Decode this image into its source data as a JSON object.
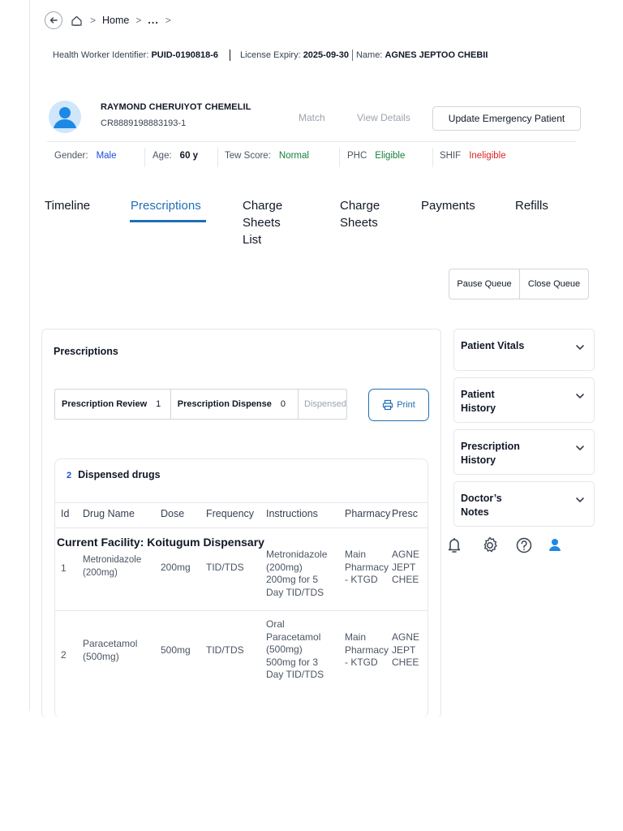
{
  "breadcrumb": {
    "home": "Home",
    "ellipsis": "...",
    "sep": ">"
  },
  "identity": {
    "worker_label": "Health Worker Identifier:",
    "worker_id": "PUID-0190818-6",
    "license_label": "License Expiry:",
    "license_date": "2025-09-30",
    "name_label": "Name:",
    "name_value": "AGNES JEPTOO CHEBII"
  },
  "patient": {
    "name": "RAYMOND CHERUIYOT CHEMELIL",
    "id": "CR8889198883193-1",
    "match": "Match",
    "view_details": "View Details",
    "update_emergency": "Update Emergency Patient"
  },
  "demographics": {
    "gender_label": "Gender:",
    "gender": "Male",
    "age_label": "Age:",
    "age": "60 y",
    "tew_label": "Tew Score:",
    "tew": "Normal",
    "phc_label": "PHC",
    "phc": "Eligible",
    "shif_label": "SHIF",
    "shif": "Ineligible"
  },
  "tabs": [
    {
      "label_lines": [
        "Timeline"
      ]
    },
    {
      "label_lines": [
        "Prescriptions"
      ]
    },
    {
      "label_lines": [
        "Charge",
        "Sheets",
        "List"
      ]
    },
    {
      "label_lines": [
        "Charge",
        "Sheets"
      ]
    },
    {
      "label_lines": [
        "Payments"
      ]
    },
    {
      "label_lines": [
        "Refills"
      ]
    }
  ],
  "queue": {
    "pause": "Pause Queue",
    "close": "Close Queue"
  },
  "prescriptions": {
    "title": "Prescriptions",
    "review_label": "Prescription Review",
    "review_count": "1",
    "dispense_label": "Prescription Dispense",
    "dispense_count": "0",
    "dispensed_label": "Dispensed",
    "print_label": "Print"
  },
  "dispensed": {
    "count": "2",
    "title": "Dispensed drugs",
    "headers": [
      "Id",
      "Drug Name",
      "Dose",
      "Frequency",
      "Instructions",
      "Pharmacy",
      "Presc"
    ],
    "facility": "Current Facility: Koitugum Dispensary",
    "rows": [
      {
        "id": "1",
        "drug_lines": [
          "Metronidazole",
          "(200mg)"
        ],
        "dose": "200mg",
        "frequency": "TID/TDS",
        "instruction_lines": [
          "Metronidazole",
          "(200mg)",
          "200mg for 5",
          "Day TID/TDS"
        ],
        "pharmacy_lines": [
          "Main",
          "Pharmacy",
          "- KTGD"
        ],
        "prescriber_lines": [
          "AGNE",
          "JEPT",
          "CHEE"
        ]
      },
      {
        "id": "2",
        "drug_lines": [
          "Paracetamol",
          "(500mg)"
        ],
        "dose": "500mg",
        "frequency": "TID/TDS",
        "instruction_lines": [
          "Oral",
          "Paracetamol",
          "(500mg)",
          "500mg for 3",
          "Day TID/TDS"
        ],
        "pharmacy_lines": [
          "Main",
          "Pharmacy",
          "- KTGD"
        ],
        "prescriber_lines": [
          "AGNE",
          "JEPT",
          "CHEE"
        ]
      }
    ]
  },
  "side_panels": [
    {
      "label_lines": [
        "Patient Vitals"
      ]
    },
    {
      "label_lines": [
        "Patient",
        "History"
      ]
    },
    {
      "label_lines": [
        "Prescription",
        "History"
      ]
    },
    {
      "label_lines": [
        "Doctor’s",
        "Notes"
      ]
    }
  ],
  "icons": [
    "bell-icon",
    "gear-icon",
    "help-icon",
    "user-icon"
  ],
  "colors": {
    "accent": "#1f6fb5",
    "eligible": "#15803d",
    "ineligible": "#dc2626",
    "avatar": "#1e88e5"
  }
}
